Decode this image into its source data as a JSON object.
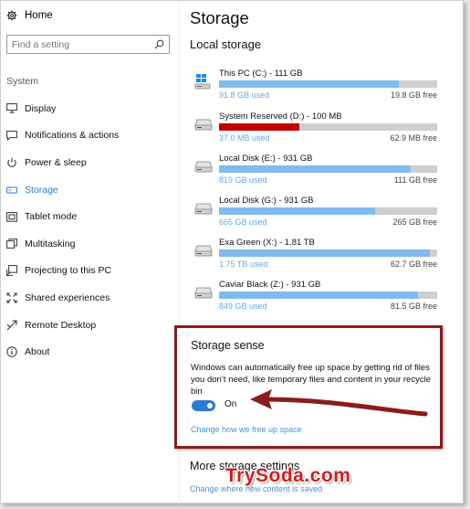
{
  "sidebar": {
    "home_label": "Home",
    "search_placeholder": "Find a setting",
    "section_label": "System",
    "items": [
      {
        "label": "Display",
        "icon": "display-icon"
      },
      {
        "label": "Notifications & actions",
        "icon": "notifications-icon"
      },
      {
        "label": "Power & sleep",
        "icon": "power-icon"
      },
      {
        "label": "Storage",
        "icon": "storage-icon",
        "active": true
      },
      {
        "label": "Tablet mode",
        "icon": "tablet-icon"
      },
      {
        "label": "Multitasking",
        "icon": "multitasking-icon"
      },
      {
        "label": "Projecting to this PC",
        "icon": "projecting-icon"
      },
      {
        "label": "Shared experiences",
        "icon": "shared-experiences-icon"
      },
      {
        "label": "Remote Desktop",
        "icon": "remote-desktop-icon"
      },
      {
        "label": "About",
        "icon": "about-icon"
      }
    ]
  },
  "main": {
    "title": "Storage",
    "local_storage_title": "Local storage",
    "drives": [
      {
        "name": "This PC (C:) - 111 GB",
        "used": "91.8 GB used",
        "free": "19.8 GB free",
        "used_fraction": 0.826,
        "warning": false,
        "icon": "windows-drive-icon"
      },
      {
        "name": "System Reserved (D:) - 100 MB",
        "used": "37.0 MB used",
        "free": "62.9 MB free",
        "used_fraction": 0.37,
        "warning": true,
        "icon": "hard-drive-icon"
      },
      {
        "name": "Local Disk (E:) - 931 GB",
        "used": "819 GB used",
        "free": "111 GB free",
        "used_fraction": 0.88,
        "warning": false,
        "icon": "hard-drive-icon"
      },
      {
        "name": "Local Disk (G:) - 931 GB",
        "used": "665 GB used",
        "free": "265 GB free",
        "used_fraction": 0.715,
        "warning": false,
        "icon": "hard-drive-icon"
      },
      {
        "name": "Exa Green (X:) - 1.81 TB",
        "used": "1.75 TB used",
        "free": "62.7 GB free",
        "used_fraction": 0.966,
        "warning": false,
        "icon": "hard-drive-icon"
      },
      {
        "name": "Caviar Black (Z:) - 931 GB",
        "used": "849 GB used",
        "free": "81.5 GB free",
        "used_fraction": 0.912,
        "warning": false,
        "icon": "hard-drive-icon"
      }
    ],
    "storage_sense": {
      "title": "Storage sense",
      "description": "Windows can automatically free up space by getting rid of files you don’t need, like temporary files and content in your recycle bin",
      "toggle_state": "On",
      "link": "Change how we free up space"
    },
    "more_title": "More storage settings",
    "more_link": "Change where new content is saved"
  },
  "watermark": "TrySoda.com",
  "colors": {
    "accent": "#2a7bd6",
    "used_bar": "#7fbbf0",
    "warning_bar": "#c00000",
    "highlight_border": "#8a1c1c"
  }
}
